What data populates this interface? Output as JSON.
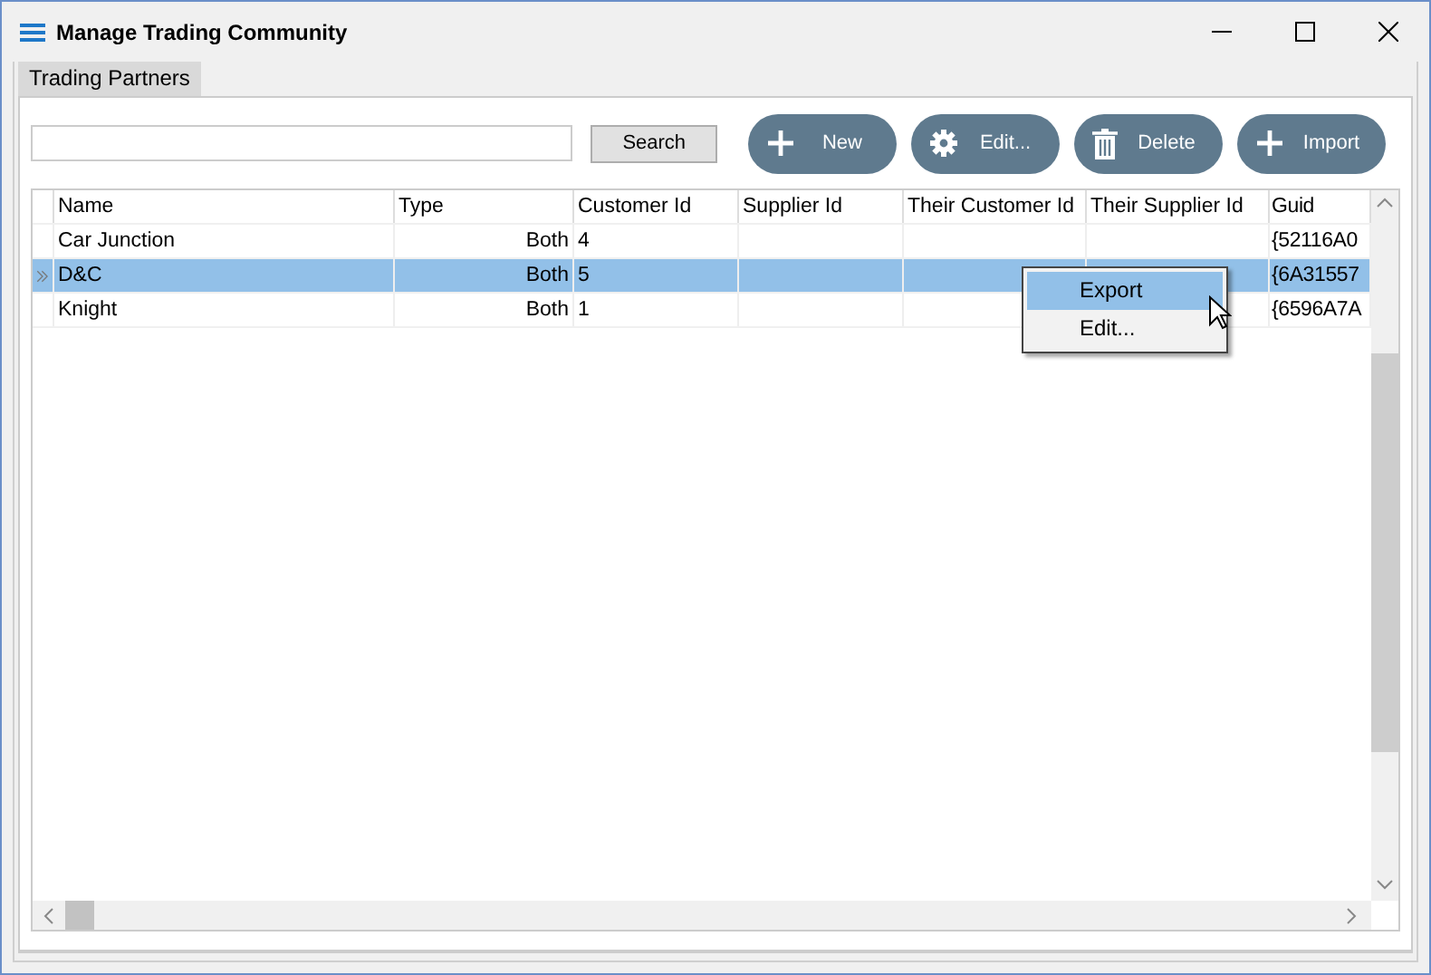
{
  "window": {
    "title": "Manage Trading Community"
  },
  "tabs": [
    {
      "label": "Trading Partners",
      "selected": true
    }
  ],
  "search": {
    "button": "Search"
  },
  "actions": [
    {
      "label": "New",
      "kind": "plus"
    },
    {
      "label": "Edit...",
      "kind": "gear"
    },
    {
      "label": "Delete",
      "kind": "trash"
    },
    {
      "label": "Import",
      "kind": "plus"
    }
  ],
  "table": {
    "columns": [
      "Name",
      "Type",
      "Customer Id",
      "Supplier Id",
      "Their Customer Id",
      "Their Supplier Id",
      "Guid"
    ],
    "rows": [
      {
        "cells": [
          "Car Junction",
          "Both",
          "4",
          "",
          "",
          "",
          "{52116A0"
        ],
        "selected": false
      },
      {
        "cells": [
          "D&C",
          "Both",
          "5",
          "",
          "",
          "",
          "{6A31557"
        ],
        "selected": true
      },
      {
        "cells": [
          "Knight",
          "Both",
          "1",
          "",
          "",
          "",
          "{6596A7A"
        ],
        "selected": false
      }
    ]
  },
  "context_menu": {
    "items": [
      {
        "label": "Export",
        "selected": true
      },
      {
        "label": "Edit...",
        "selected": false
      }
    ]
  }
}
